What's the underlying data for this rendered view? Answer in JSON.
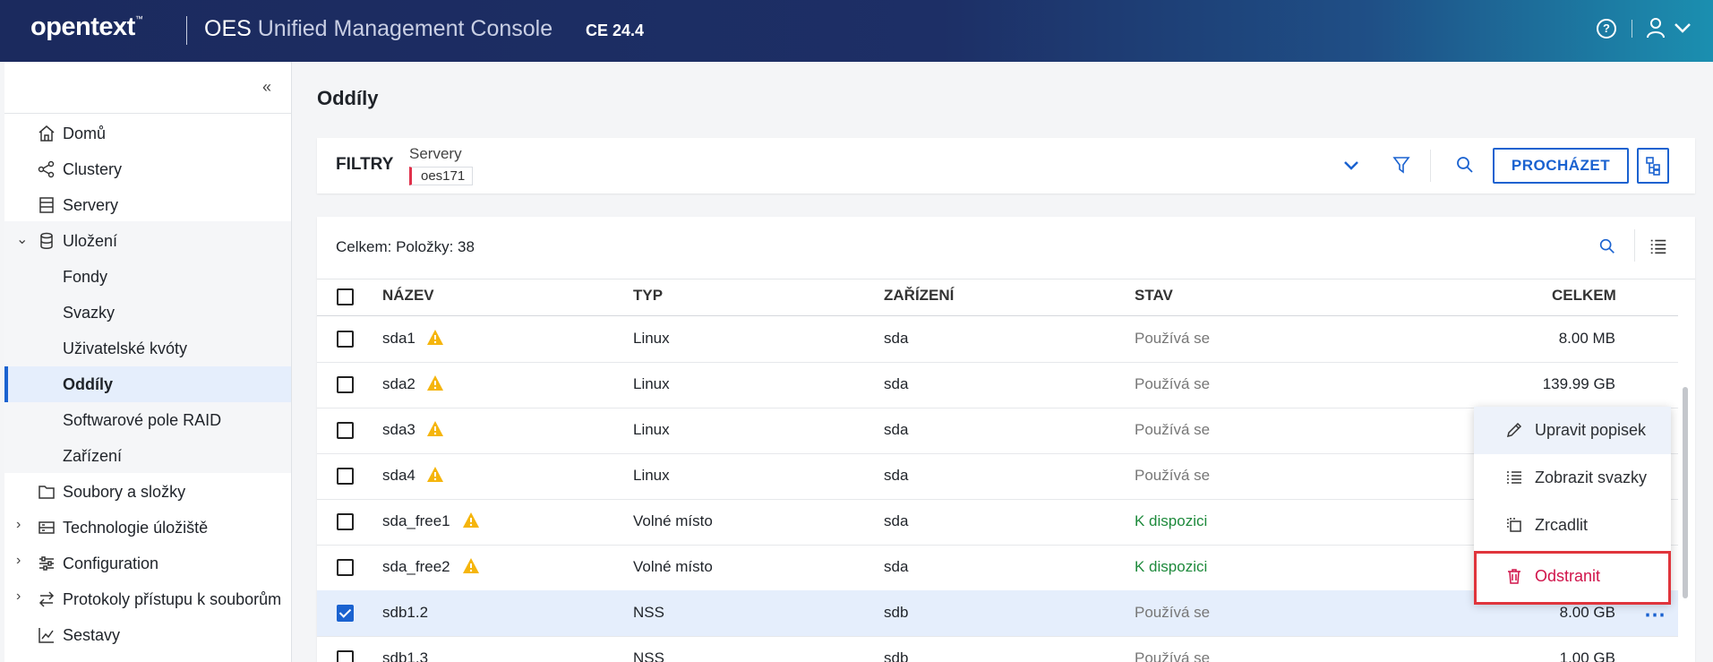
{
  "header": {
    "logo": "opentext",
    "logo_tm": "™",
    "app_title_bold": "OES",
    "app_title_rest": "Unified Management Console",
    "version": "CE 24.4",
    "help_icon": "help-circle-icon",
    "user_icon": "user-icon"
  },
  "sidebar": {
    "collapse_label": "«",
    "items": [
      {
        "label": "Domů",
        "icon": "home-icon"
      },
      {
        "label": "Clustery",
        "icon": "share-nodes-icon"
      },
      {
        "label": "Servery",
        "icon": "server-icon"
      },
      {
        "label": "Uložení",
        "icon": "database-icon",
        "expanded": true
      },
      {
        "label": "Fondy"
      },
      {
        "label": "Svazky"
      },
      {
        "label": "Uživatelské kvóty"
      },
      {
        "label": "Oddíly",
        "active": true
      },
      {
        "label": "Softwarové pole RAID"
      },
      {
        "label": "Zařízení"
      },
      {
        "label": "Soubory a složky",
        "icon": "folder-icon"
      },
      {
        "label": "Technologie úložiště",
        "icon": "storage-icon"
      },
      {
        "label": "Configuration",
        "icon": "sliders-icon"
      },
      {
        "label": "Protokoly přístupu k souborům",
        "icon": "transfer-icon"
      },
      {
        "label": "Sestavy",
        "icon": "chart-icon"
      }
    ]
  },
  "page": {
    "title": "Oddíly"
  },
  "filters": {
    "label": "FILTRY",
    "server_label": "Servery",
    "server_value": "oes171",
    "browse_label": "PROCHÁZET"
  },
  "table": {
    "total": "Celkem: Položky: 38",
    "columns": [
      "NÁZEV",
      "TYP",
      "ZAŘÍZENÍ",
      "STAV",
      "CELKEM"
    ],
    "rows": [
      {
        "name": "sda1",
        "type": "Linux",
        "device": "sda",
        "status": "Používá se",
        "total": "8.00 MB",
        "warn": true,
        "checked": false
      },
      {
        "name": "sda2",
        "type": "Linux",
        "device": "sda",
        "status": "Používá se",
        "total": "139.99 GB",
        "warn": true,
        "checked": false
      },
      {
        "name": "sda3",
        "type": "Linux",
        "device": "sda",
        "status": "Používá se",
        "total": "",
        "warn": true,
        "checked": false
      },
      {
        "name": "sda4",
        "type": "Linux",
        "device": "sda",
        "status": "Používá se",
        "total": "",
        "warn": true,
        "checked": false
      },
      {
        "name": "sda_free1",
        "type": "Volné místo",
        "device": "sda",
        "status": "K dispozici",
        "total": "",
        "warn": true,
        "checked": false
      },
      {
        "name": "sda_free2",
        "type": "Volné místo",
        "device": "sda",
        "status": "K dispozici",
        "total": "",
        "warn": true,
        "checked": false
      },
      {
        "name": "sdb1.2",
        "type": "NSS",
        "device": "sdb",
        "status": "Používá se",
        "total": "8.00 GB",
        "warn": false,
        "checked": true
      },
      {
        "name": "sdb1.3",
        "type": "NSS",
        "device": "sdb",
        "status": "Používá se",
        "total": "1.00 GB",
        "warn": false,
        "checked": false
      }
    ],
    "more_label": "⋯"
  },
  "context_menu": {
    "items": [
      {
        "label": "Upravit popisek",
        "icon": "pencil-icon"
      },
      {
        "label": "Zobrazit svazky",
        "icon": "list-icon"
      },
      {
        "label": "Zrcadlit",
        "icon": "mirror-icon"
      },
      {
        "label": "Odstranit",
        "icon": "trash-icon"
      }
    ]
  },
  "colors": {
    "accent": "#1a62d0",
    "danger": "#d0134a",
    "available": "#1e8a3c"
  }
}
